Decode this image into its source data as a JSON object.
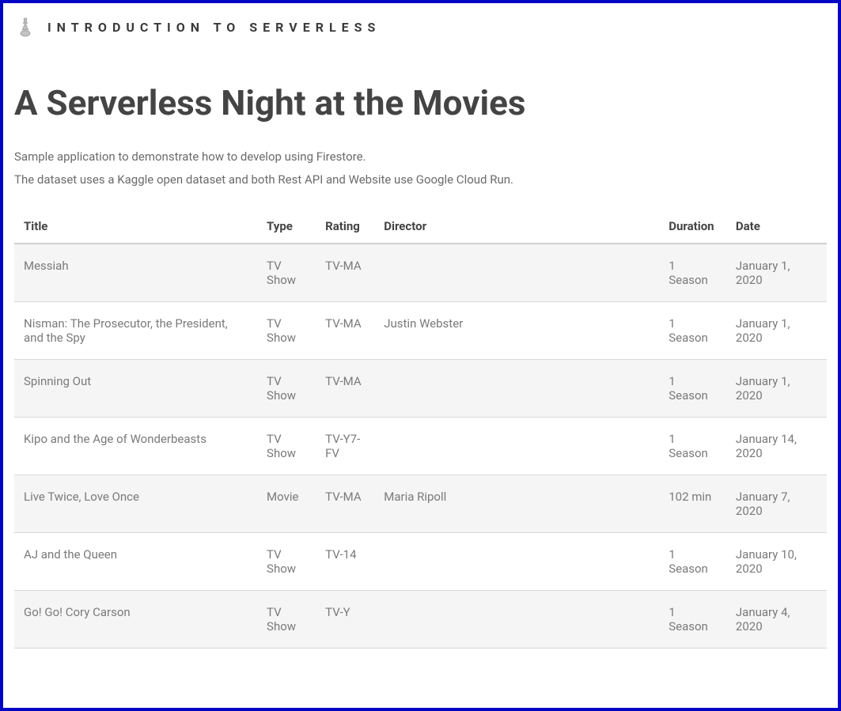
{
  "header": {
    "title": "Introduction to Serverless"
  },
  "page": {
    "heading": "A Serverless Night at the Movies",
    "description_line1": "Sample application to demonstrate how to develop using Firestore.",
    "description_line2": "The dataset uses a Kaggle open dataset and both Rest API and Website use Google Cloud Run."
  },
  "table": {
    "headers": {
      "title": "Title",
      "type": "Type",
      "rating": "Rating",
      "director": "Director",
      "duration": "Duration",
      "date": "Date"
    },
    "rows": [
      {
        "title": "Messiah",
        "type": "TV Show",
        "rating": "TV-MA",
        "director": "",
        "duration": "1 Season",
        "date": "January 1, 2020"
      },
      {
        "title": "Nisman: The Prosecutor, the President, and the Spy",
        "type": "TV Show",
        "rating": "TV-MA",
        "director": "Justin Webster",
        "duration": "1 Season",
        "date": "January 1, 2020"
      },
      {
        "title": "Spinning Out",
        "type": "TV Show",
        "rating": "TV-MA",
        "director": "",
        "duration": "1 Season",
        "date": "January 1, 2020"
      },
      {
        "title": "Kipo and the Age of Wonderbeasts",
        "type": "TV Show",
        "rating": "TV-Y7-FV",
        "director": "",
        "duration": "1 Season",
        "date": "January 14, 2020"
      },
      {
        "title": "Live Twice, Love Once",
        "type": "Movie",
        "rating": "TV-MA",
        "director": "Maria Ripoll",
        "duration": "102 min",
        "date": "January 7, 2020"
      },
      {
        "title": "AJ and the Queen",
        "type": "TV Show",
        "rating": "TV-14",
        "director": "",
        "duration": "1 Season",
        "date": "January 10, 2020"
      },
      {
        "title": "Go! Go! Cory Carson",
        "type": "TV Show",
        "rating": "TV-Y",
        "director": "",
        "duration": "1 Season",
        "date": "January 4, 2020"
      }
    ]
  }
}
